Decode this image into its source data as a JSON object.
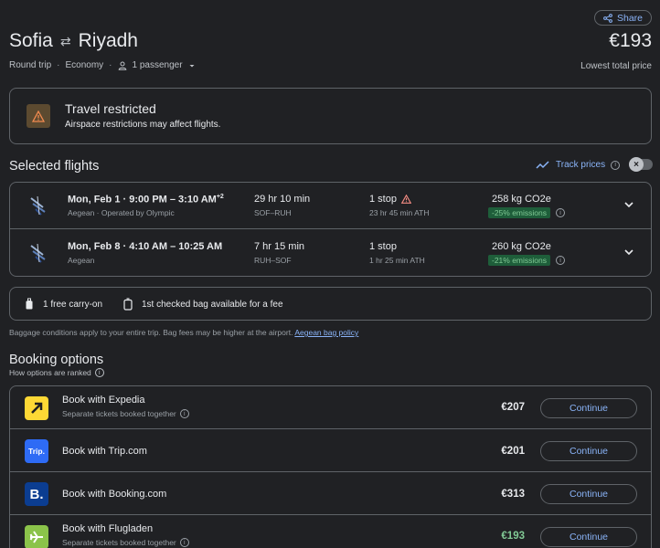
{
  "header": {
    "share_label": "Share",
    "origin": "Sofia",
    "destination": "Riyadh",
    "price": "€193",
    "trip_type": "Round trip",
    "cabin": "Economy",
    "passengers": "1 passenger",
    "price_note": "Lowest total price"
  },
  "restriction": {
    "title": "Travel restricted",
    "description": "Airspace restrictions may affect flights."
  },
  "selected_flights": {
    "title": "Selected flights",
    "track_label": "Track prices",
    "flights": [
      {
        "date": "Mon, Feb 1",
        "times": "9:00 PM – 3:10 AM",
        "day_offset": "+2",
        "airline": "Aegean · Operated by Olympic",
        "duration": "29 hr 10 min",
        "route": "SOF–RUH",
        "stops": "1 stop",
        "layover": "23 hr 45 min ATH",
        "emissions": "258 kg CO2e",
        "emissions_badge": "-25% emissions"
      },
      {
        "date": "Mon, Feb 8",
        "times": "4:10 AM – 10:25 AM",
        "day_offset": "",
        "airline": "Aegean",
        "duration": "7 hr 15 min",
        "route": "RUH–SOF",
        "stops": "1 stop",
        "layover": "1 hr 25 min ATH",
        "emissions": "260 kg CO2e",
        "emissions_badge": "-21% emissions"
      }
    ]
  },
  "baggage": {
    "carry_on": "1 free carry-on",
    "checked": "1st checked bag available for a fee",
    "note": "Baggage conditions apply to your entire trip. Bag fees may be higher at the airport.",
    "policy_link": "Aegean bag policy"
  },
  "booking": {
    "title": "Booking options",
    "how_ranked": "How options are ranked",
    "continue_label": "Continue",
    "options": [
      {
        "name": "Book with Expedia",
        "sub": "Separate tickets booked together",
        "price": "€207",
        "logo_text": "",
        "logo_bg": "#fdd835"
      },
      {
        "name": "Book with Trip.com",
        "sub": "",
        "price": "€201",
        "logo_text": "Trip.",
        "logo_bg": "#2e6bf5"
      },
      {
        "name": "Book with Booking.com",
        "sub": "",
        "price": "€313",
        "logo_text": "B.",
        "logo_bg": "#0b3d91"
      },
      {
        "name": "Book with Flugladen",
        "sub": "Separate tickets booked together",
        "price": "€193",
        "logo_text": "",
        "logo_bg": "#8bc34a"
      }
    ]
  }
}
